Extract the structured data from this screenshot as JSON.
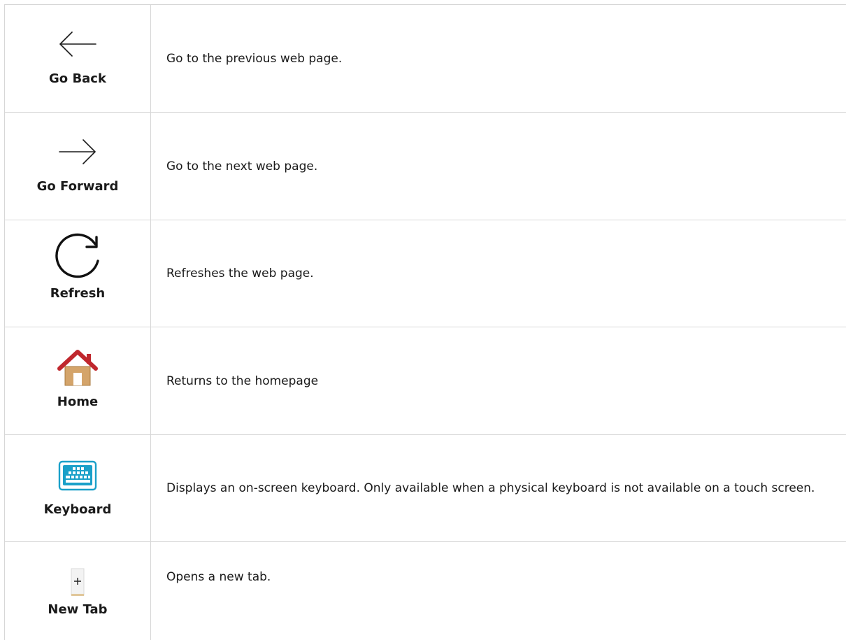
{
  "rows": [
    {
      "icon": "arrow-left-icon",
      "label": "Go Back",
      "description": "Go to the previous web page."
    },
    {
      "icon": "arrow-right-icon",
      "label": "Go Forward",
      "description": "Go to the next web page."
    },
    {
      "icon": "refresh-icon",
      "label": "Refresh",
      "description": "Refreshes the web page."
    },
    {
      "icon": "home-icon",
      "label": "Home",
      "description": "Returns to the homepage"
    },
    {
      "icon": "keyboard-icon",
      "label": "Keyboard",
      "description": "Displays an on-screen keyboard. Only available when a physical keyboard is not available on a touch screen."
    },
    {
      "icon": "new-tab-icon",
      "label": "New Tab",
      "description": "Opens a new tab."
    }
  ],
  "colors": {
    "border": "#d7d7d7",
    "home_roof": "#c0272d",
    "home_body": "#d4a46a",
    "keyboard": "#1aa0c9"
  }
}
